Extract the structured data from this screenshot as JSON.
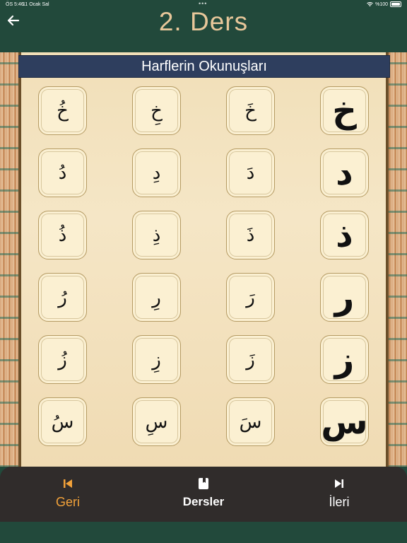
{
  "status_bar": {
    "time": "ÖS 5:46",
    "date": "11 Ocak Sal",
    "battery": "%100"
  },
  "header": {
    "title": "2. Ders",
    "back_icon": "arrow-left-icon"
  },
  "section": {
    "title": "Harflerin Okunuşları"
  },
  "letter_rows": [
    [
      "خُ",
      "خِ",
      "خَ",
      "خ"
    ],
    [
      "دُ",
      "دِ",
      "دَ",
      "د"
    ],
    [
      "ذُ",
      "ذِ",
      "ذَ",
      "ذ"
    ],
    [
      "رُ",
      "رِ",
      "رَ",
      "ر"
    ],
    [
      "زُ",
      "زِ",
      "زَ",
      "ز"
    ],
    [
      "سُ",
      "سِ",
      "سَ",
      "س"
    ]
  ],
  "bottom_nav": {
    "prev_label": "Geri",
    "prev_icon": "skip-back-icon",
    "lessons_label": "Dersler",
    "lessons_icon": "book-icon",
    "next_label": "İleri",
    "next_icon": "skip-forward-icon"
  },
  "colors": {
    "header_bg": "#22493b",
    "title": "#e8c79a",
    "section_bar": "#2e3e5e",
    "tile_bg": "#fbf0d2",
    "nav_bg": "#302c2b",
    "nav_active": "#f2a23a"
  }
}
